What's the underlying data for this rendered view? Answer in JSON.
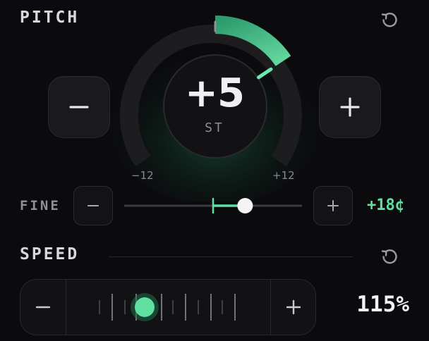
{
  "pitch": {
    "title": "PITCH",
    "value": "+5",
    "unit": "ST",
    "min_label": "−12",
    "max_label": "+12",
    "semitones": 5,
    "range": [
      -12,
      12
    ],
    "accent": "#5fe0a0"
  },
  "fine": {
    "label": "FINE",
    "value": "+18¢",
    "cents": 18,
    "range": [
      -50,
      50
    ]
  },
  "speed": {
    "title": "SPEED",
    "value": "115%",
    "percent": 115
  },
  "icons": {
    "reset": "reset-icon",
    "minus": "minus-icon",
    "plus": "plus-icon"
  }
}
